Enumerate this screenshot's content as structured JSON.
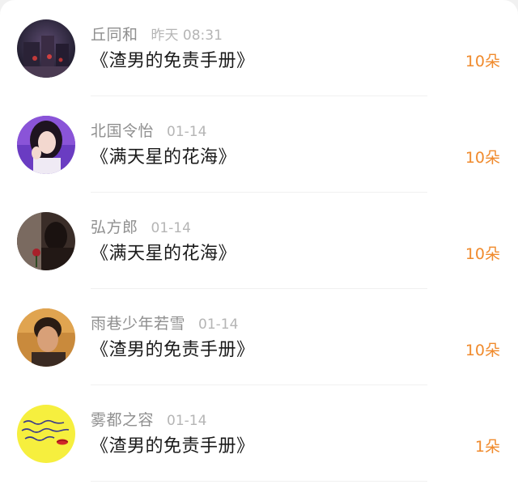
{
  "list": {
    "items": [
      {
        "name": "丘同和",
        "time": "昨天 08:31",
        "title": "《渣男的免责手册》",
        "count": "10朵",
        "avatar": "avatar-dark-scene"
      },
      {
        "name": "北国令怡",
        "time": "01-14",
        "title": "《满天星的花海》",
        "count": "10朵",
        "avatar": "avatar-woman-portrait"
      },
      {
        "name": "弘方郎",
        "time": "01-14",
        "title": "《满天星的花海》",
        "count": "10朵",
        "avatar": "avatar-person-with-rose"
      },
      {
        "name": "雨巷少年若雪",
        "time": "01-14",
        "title": "《渣男的免责手册》",
        "count": "10朵",
        "avatar": "avatar-man-portrait"
      },
      {
        "name": "雾都之容",
        "time": "01-14",
        "title": "《渣男的免责手册》",
        "count": "1朵",
        "avatar": "avatar-handwriting-note"
      }
    ]
  },
  "colors": {
    "accent": "#f08a2c",
    "name_text": "#8f8f8f",
    "time_text": "#b5b5b5",
    "title_text": "#1a1a1a",
    "background": "#ffffff"
  }
}
